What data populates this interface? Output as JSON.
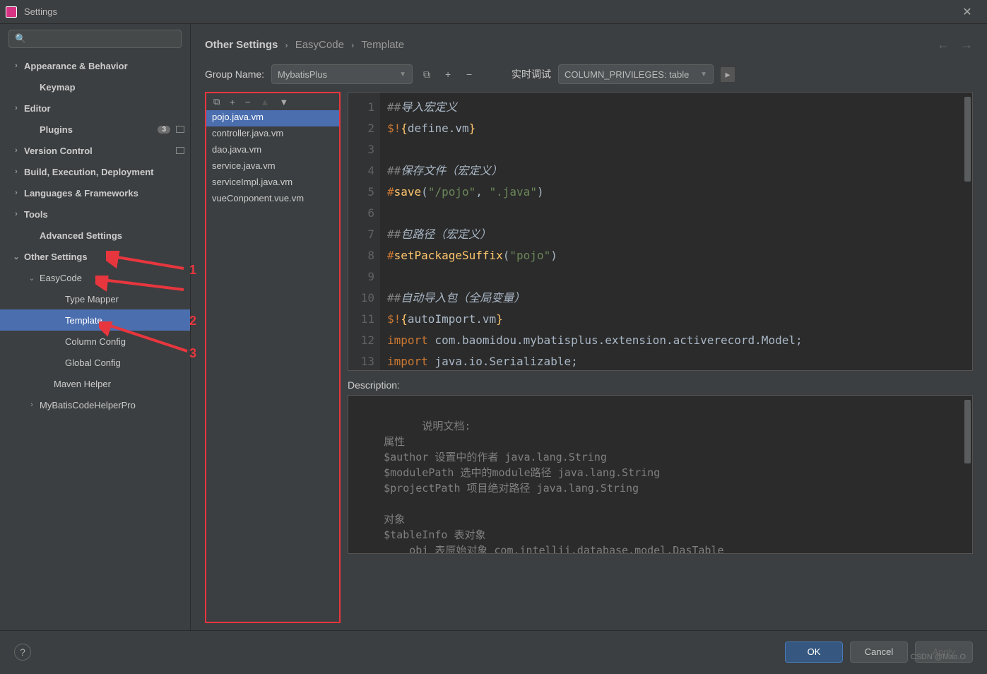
{
  "window": {
    "title": "Settings"
  },
  "search": {
    "placeholder": ""
  },
  "sidebar": {
    "items": [
      {
        "label": "Appearance & Behavior",
        "bold": true,
        "chev": "›",
        "depth": 0
      },
      {
        "label": "Keymap",
        "bold": true,
        "depth": 1,
        "chev": ""
      },
      {
        "label": "Editor",
        "bold": true,
        "chev": "›",
        "depth": 0
      },
      {
        "label": "Plugins",
        "bold": true,
        "depth": 1,
        "chev": "",
        "badge": "3",
        "icon": true
      },
      {
        "label": "Version Control",
        "bold": true,
        "chev": "›",
        "depth": 0,
        "icon": true
      },
      {
        "label": "Build, Execution, Deployment",
        "bold": true,
        "chev": "›",
        "depth": 0
      },
      {
        "label": "Languages & Frameworks",
        "bold": true,
        "chev": "›",
        "depth": 0
      },
      {
        "label": "Tools",
        "bold": true,
        "chev": "›",
        "depth": 0
      },
      {
        "label": "Advanced Settings",
        "bold": true,
        "depth": 1,
        "chev": ""
      },
      {
        "label": "Other Settings",
        "bold": true,
        "chev": "⌄",
        "depth": 0
      },
      {
        "label": "EasyCode",
        "bold": false,
        "chev": "⌄",
        "depth": 1
      },
      {
        "label": "Type Mapper",
        "bold": false,
        "depth": 3,
        "chev": ""
      },
      {
        "label": "Template",
        "bold": false,
        "depth": 3,
        "chev": "",
        "selected": true
      },
      {
        "label": "Column Config",
        "bold": false,
        "depth": 3,
        "chev": ""
      },
      {
        "label": "Global Config",
        "bold": false,
        "depth": 3,
        "chev": ""
      },
      {
        "label": "Maven Helper",
        "bold": false,
        "depth": 2,
        "chev": ""
      },
      {
        "label": "MyBatisCodeHelperPro",
        "bold": false,
        "chev": "›",
        "depth": 1
      }
    ]
  },
  "breadcrumb": {
    "a": "Other Settings",
    "b": "EasyCode",
    "c": "Template"
  },
  "toolbar": {
    "group_name_label": "Group Name:",
    "group_name_value": "MybatisPlus",
    "realtime_label": "实时调试",
    "realtime_value": "COLUMN_PRIVILEGES: table"
  },
  "templates": {
    "items": [
      {
        "label": "pojo.java.vm",
        "selected": true
      },
      {
        "label": "controller.java.vm"
      },
      {
        "label": "dao.java.vm"
      },
      {
        "label": "service.java.vm"
      },
      {
        "label": "serviceImpl.java.vm"
      },
      {
        "label": "vueConponent.vue.vm"
      }
    ]
  },
  "editor": {
    "lines": [
      "##导入宏定义",
      "$!{define.vm}",
      "",
      "##保存文件（宏定义）",
      "#save(\"/pojo\", \".java\")",
      "",
      "##包路径（宏定义）",
      "#setPackageSuffix(\"pojo\")",
      "",
      "##自动导入包（全局变量）",
      "$!{autoImport.vm}",
      "import com.baomidou.mybatisplus.extension.activerecord.Model;",
      "import java.io.Serializable;"
    ]
  },
  "description": {
    "label": "Description:",
    "text": "说明文档:\n    属性\n    $author 设置中的作者 java.lang.String\n    $modulePath 选中的module路径 java.lang.String\n    $projectPath 项目绝对路径 java.lang.String\n\n    对象\n    $tableInfo 表对象\n        obj 表原始对象 com.intellij.database.model.DasTable\n        preName 表前缀 java.lang.String\n        name 表名（转换后的首字母大写）java.lang.String"
  },
  "footer": {
    "ok": "OK",
    "cancel": "Cancel",
    "apply": "Apply"
  },
  "annotations": {
    "n1": "1",
    "n2": "2",
    "n3": "3"
  },
  "watermark": "CSDN @Mao.O",
  "icons": {
    "search": "🔍"
  }
}
